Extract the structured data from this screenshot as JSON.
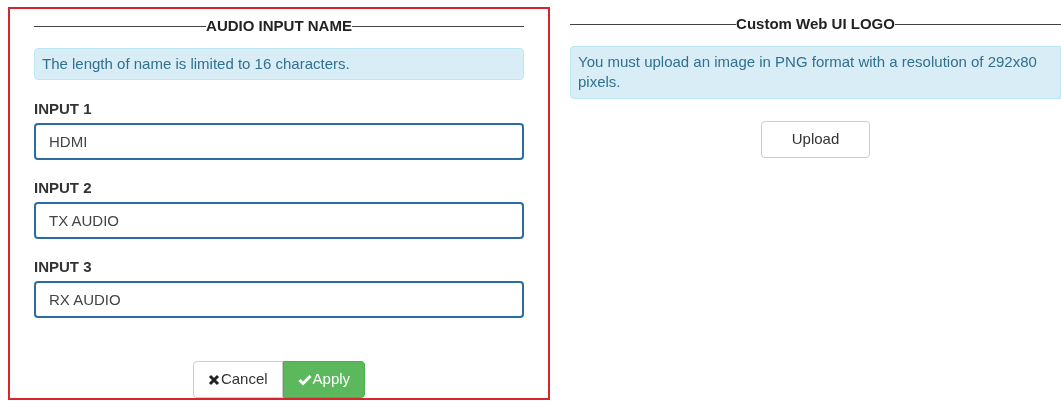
{
  "audio_input_panel": {
    "title": "AUDIO INPUT NAME",
    "notice": "The length of name is limited to 16 characters.",
    "inputs": [
      {
        "label": "INPUT 1",
        "value": "HDMI"
      },
      {
        "label": "INPUT 2",
        "value": "TX AUDIO"
      },
      {
        "label": "INPUT 3",
        "value": "RX AUDIO"
      }
    ],
    "buttons": [
      {
        "kind": "cancel",
        "label": "Cancel"
      },
      {
        "kind": "apply",
        "label": "Apply"
      }
    ]
  },
  "logo_panel": {
    "title": "Custom Web UI LOGO",
    "notice": "You must upload an image in PNG format with a resolution of 292x80 pixels.",
    "button": "Upload"
  }
}
